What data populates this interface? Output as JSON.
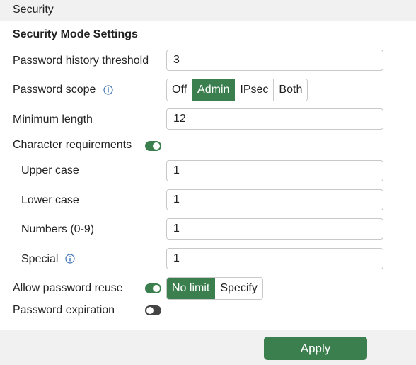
{
  "header": {
    "title": "Security"
  },
  "section": {
    "title": "Security Mode Settings"
  },
  "fields": {
    "password_history": {
      "label": "Password history threshold",
      "value": "3"
    },
    "password_scope": {
      "label": "Password scope",
      "options": [
        "Off",
        "Admin",
        "IPsec",
        "Both"
      ],
      "selected": "Admin"
    },
    "minimum_length": {
      "label": "Minimum length",
      "value": "12"
    },
    "character_requirements": {
      "label": "Character requirements",
      "enabled": true
    },
    "upper_case": {
      "label": "Upper case",
      "value": "1"
    },
    "lower_case": {
      "label": "Lower case",
      "value": "1"
    },
    "numbers": {
      "label": "Numbers (0-9)",
      "value": "1"
    },
    "special": {
      "label": "Special",
      "value": "1"
    },
    "allow_password_reuse": {
      "label": "Allow password reuse",
      "enabled": true,
      "options": [
        "No limit",
        "Specify"
      ],
      "selected": "No limit"
    },
    "password_expiration": {
      "label": "Password expiration",
      "enabled": false
    }
  },
  "footer": {
    "apply_label": "Apply"
  },
  "icons": {
    "info": "info-icon",
    "toggle": "toggle-switch"
  },
  "colors": {
    "accent": "#3b7f4f",
    "header_bg": "#f1f1f1",
    "toggle_off": "#444444"
  }
}
